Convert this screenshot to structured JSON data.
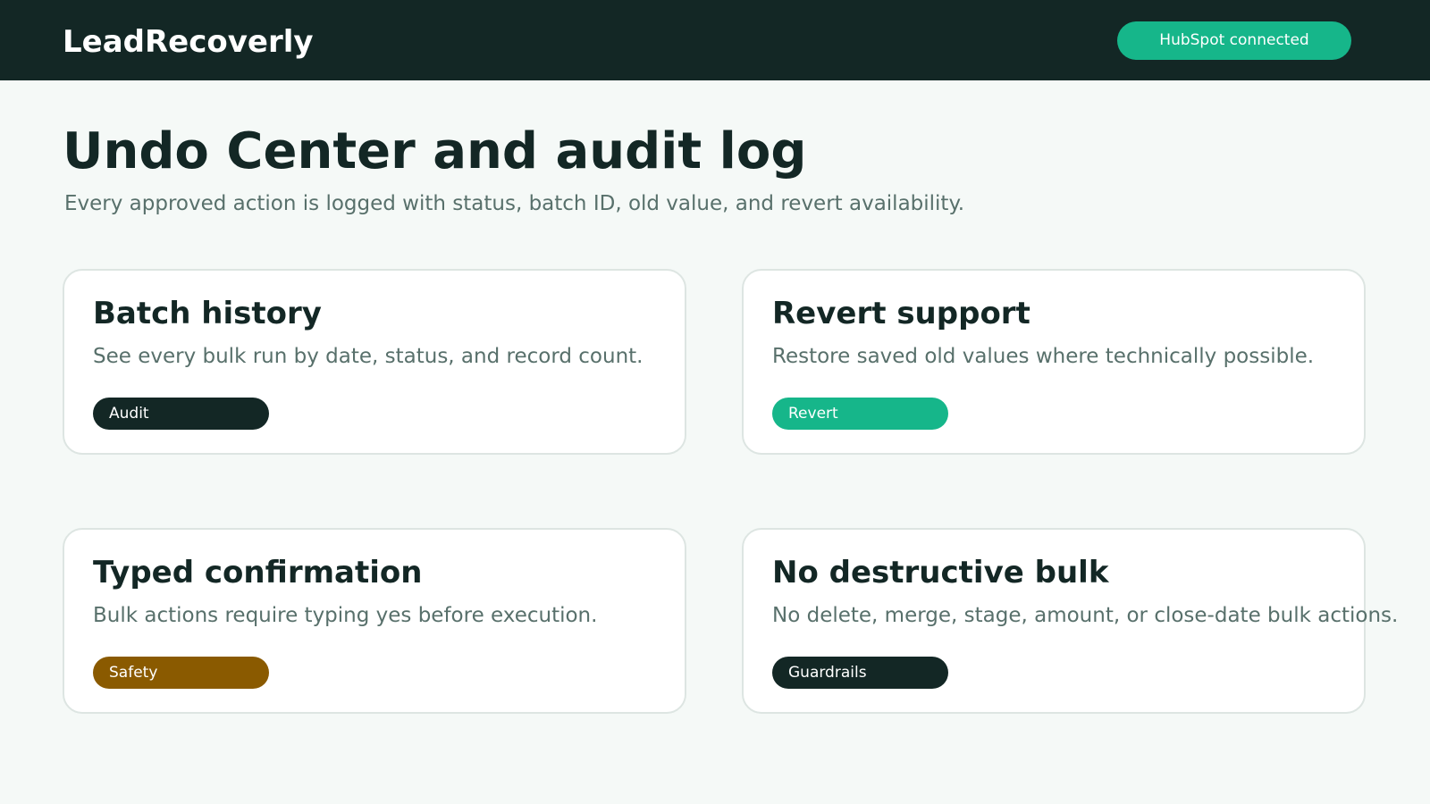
{
  "app": {
    "brand": "LeadRecoverly",
    "connection_status": "HubSpot connected"
  },
  "page": {
    "title": "Undo Center and audit log",
    "subtitle": "Every approved action is logged with status, batch ID, old value, and revert availability."
  },
  "cards": [
    {
      "title": "Batch history",
      "description": "See every bulk run by date, status, and record count.",
      "tag": "Audit",
      "tag_color": "#132725"
    },
    {
      "title": "Revert support",
      "description": "Restore saved old values where technically possible.",
      "tag": "Revert",
      "tag_color": "#16b68a"
    },
    {
      "title": "Typed confirmation",
      "description": "Bulk actions require typing yes before execution.",
      "tag": "Safety",
      "tag_color": "#8a5a00"
    },
    {
      "title": "No destructive bulk",
      "description": "No delete, merge, stage, amount, or close-date bulk actions.",
      "tag": "Guardrails",
      "tag_color": "#132725"
    }
  ],
  "colors": {
    "header_bg": "#132725",
    "accent": "#16b68a",
    "page_bg": "#f5f9f7",
    "heading_text": "#132725",
    "muted_text": "#58706b",
    "card_border": "#dde5e2"
  }
}
